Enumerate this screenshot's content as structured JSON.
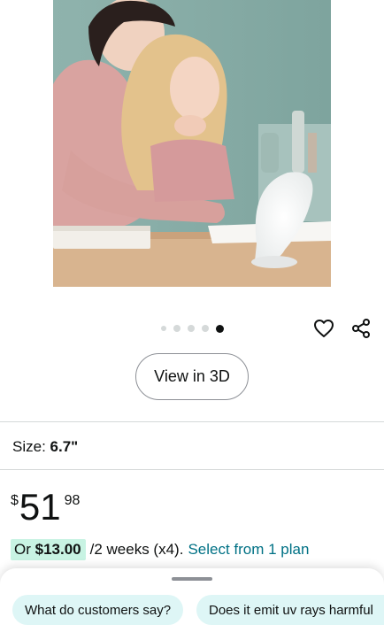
{
  "carousel": {
    "dot_count": 5,
    "active_index": 4
  },
  "actions": {
    "view_3d_label": "View in 3D"
  },
  "size": {
    "label": "Size:",
    "value": "6.7\""
  },
  "price": {
    "currency": "$",
    "whole": "51",
    "fraction": "98"
  },
  "installment": {
    "prefix": "Or",
    "amount": "$13.00",
    "term": "/2 weeks (x4).",
    "link_label": "Select from 1 plan"
  },
  "questions": [
    {
      "label": "What do customers say?"
    },
    {
      "label": "Does it emit uv rays harmful"
    }
  ],
  "colors": {
    "accent_link": "#007185",
    "chip_bg": "#def6f6",
    "highlight_bg": "#c8f3e3"
  },
  "icons": [
    "heart-icon",
    "share-icon"
  ]
}
